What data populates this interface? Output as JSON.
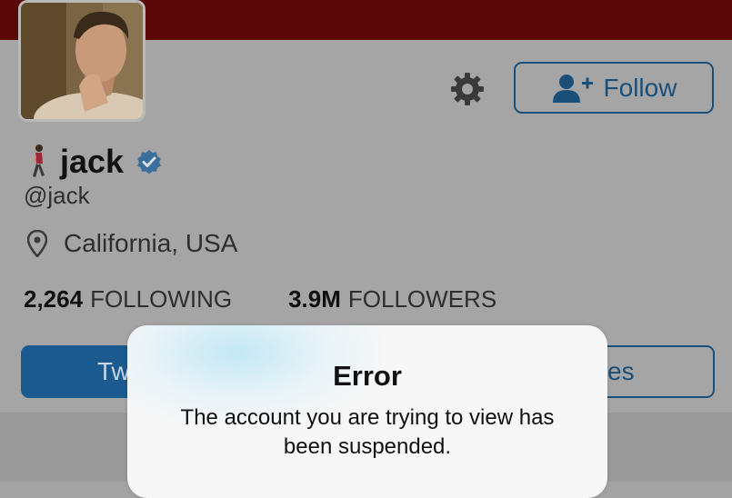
{
  "profile": {
    "display_name": "jack",
    "handle": "@jack",
    "location": "California, USA",
    "verified": true
  },
  "actions": {
    "follow_label": "Follow",
    "settings_icon": "gear-icon"
  },
  "stats": {
    "following_count": "2,264",
    "following_label": "FOLLOWING",
    "followers_count": "3.9M",
    "followers_label": "FOLLOWERS"
  },
  "tabs": {
    "tweets_partial": "Tw",
    "likes_partial": "es"
  },
  "alert": {
    "title": "Error",
    "message": "The account you are trying to view has been suspended."
  },
  "colors": {
    "banner": "#5c0708",
    "accent": "#1a4f7a",
    "verified": "#3a6f9c",
    "dim_overlay": "#a5a5a5"
  }
}
